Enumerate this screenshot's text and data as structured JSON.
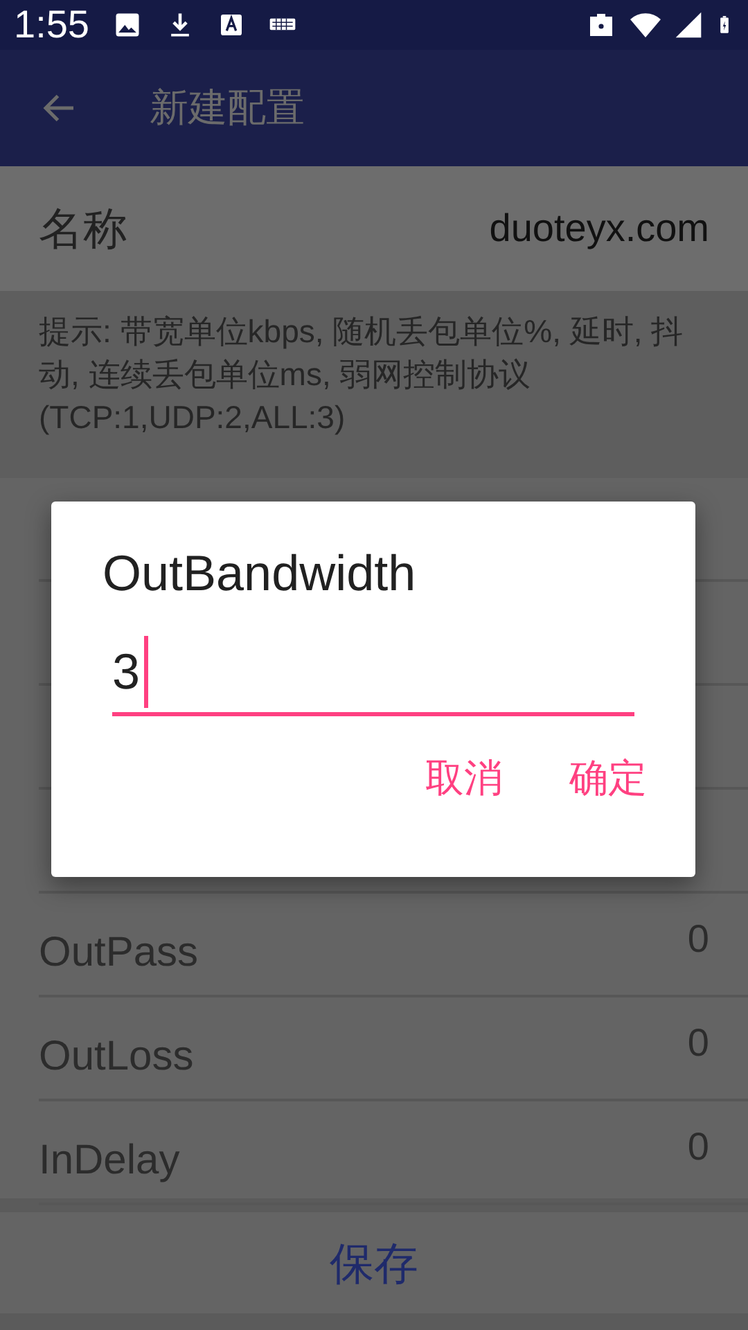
{
  "status_bar": {
    "time": "1:55"
  },
  "app_bar": {
    "title": "新建配置"
  },
  "name_field": {
    "label": "名称",
    "value": "duoteyx.com"
  },
  "hint": "提示: 带宽单位kbps, 随机丢包单位%, 延时, 抖动, 连续丢包单位ms, 弱网控制协议(TCP:1,UDP:2,ALL:3)",
  "rows": [
    {
      "label": "OutPass",
      "value": "0"
    },
    {
      "label": "OutLoss",
      "value": "0"
    },
    {
      "label": "InDelay",
      "value": "0"
    }
  ],
  "save_button": "保存",
  "dialog": {
    "title": "OutBandwidth",
    "value": "3",
    "focused": true,
    "buttons": [
      "取消",
      "确定"
    ]
  }
}
